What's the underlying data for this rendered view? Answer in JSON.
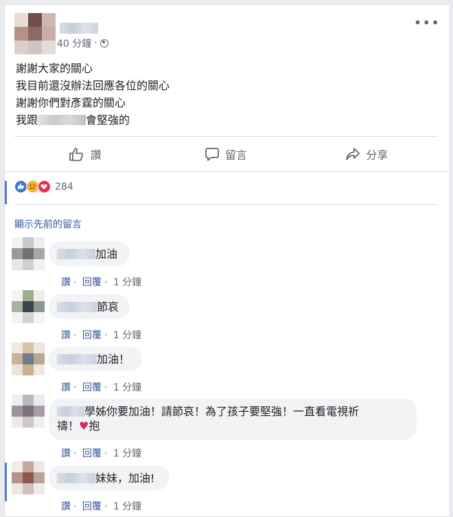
{
  "post": {
    "time": "40 分鐘",
    "lines": [
      "謝謝大家的關心",
      "我目前還沒辦法回應各位的關心",
      "謝謝你們對彥霆的關心"
    ],
    "last_line_prefix": "我跟",
    "last_line_suffix": "會堅強的"
  },
  "actions": {
    "like": "讚",
    "comment": "留言",
    "share": "分享"
  },
  "reactions": {
    "count": "284",
    "types": [
      "like",
      "sad",
      "love"
    ]
  },
  "previous_comments_link": "顯示先前的留言",
  "comment_actions": {
    "like": "讚",
    "reply": "回覆",
    "dot": "·"
  },
  "comments": [
    {
      "text": "加油",
      "time": "1 分鐘"
    },
    {
      "text": "節哀",
      "time": "1 分鐘"
    },
    {
      "text": "加油！",
      "time": "1 分鐘"
    },
    {
      "text_line1": "學姊你要加油！請節哀！為了孩子要堅強！一直看電視祈",
      "text_line2_prefix": "禱！",
      "text_line2_suffix": "抱",
      "time": "1 分鐘"
    },
    {
      "text": "妹妹，加油!",
      "time": "1 分鐘"
    }
  ],
  "colors": {
    "link": "#385898",
    "secondary_text": "#616770",
    "bubble": "#f2f3f5",
    "accent_bar": "#4b7bd6"
  }
}
